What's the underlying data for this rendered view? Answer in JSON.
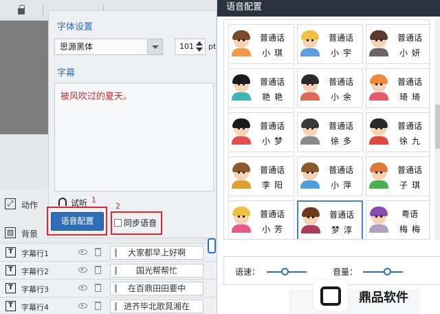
{
  "editor": {
    "tools": [
      {
        "label": "动作"
      },
      {
        "label": "背景"
      }
    ],
    "tracks": [
      {
        "label": "字幕行1",
        "clip": "大家都早上好啊"
      },
      {
        "label": "字幕行2",
        "clip": "国光帮帮忙"
      },
      {
        "label": "字幕行3",
        "clip": "在百鼎田田要中"
      },
      {
        "label": "字幕行4",
        "clip": "进齐毕北歌晁湘在"
      }
    ]
  },
  "font_panel": {
    "font_heading": "字体设置",
    "font_name": "思源黑体",
    "font_size": "101",
    "unit": "pt",
    "subtitle_heading": "字幕",
    "subtitle_text": "被风吹过的夏天。",
    "listen_label": "试听",
    "voice_config_button": "语音配置",
    "sync_voice_label": "同步语音",
    "sync_voice_checked": false,
    "annotation_1": "1",
    "annotation_2": "2"
  },
  "voice_dialog": {
    "title": "语音配置",
    "voices": [
      {
        "type": "普通话",
        "name": "小琪",
        "hair": "#7a4a2a",
        "shirt": "#f29a4a"
      },
      {
        "type": "普通话",
        "name": "小宇",
        "hair": "#f0c040",
        "shirt": "#5aa0e0"
      },
      {
        "type": "普通话",
        "name": "小妍",
        "hair": "#5a3a2a",
        "shirt": "#666666"
      },
      {
        "type": "普通话",
        "name": "艳艳",
        "hair": "#1c1c1c",
        "shirt": "#3fb6b6"
      },
      {
        "type": "普通话",
        "name": "小余",
        "hair": "#2a2a2a",
        "shirt": "#e06a5a"
      },
      {
        "type": "普通话",
        "name": "琦琦",
        "hair": "#f08a3a",
        "shirt": "#e85a6a"
      },
      {
        "type": "普通话",
        "name": "小梦",
        "hair": "#1c1c1c",
        "shirt": "#e05050"
      },
      {
        "type": "普通话",
        "name": "徐多",
        "hair": "#3a3a3a",
        "shirt": "#8a8a8a"
      },
      {
        "type": "普通话",
        "name": "徐九",
        "hair": "#2a2a2a",
        "shirt": "#e04a3a"
      },
      {
        "type": "普通话",
        "name": "李阳",
        "hair": "#8a5a2a",
        "shirt": "#e0a030"
      },
      {
        "type": "普通话",
        "name": "小萍",
        "hair": "#8a5a2a",
        "shirt": "#4aa0e0"
      },
      {
        "type": "普通话",
        "name": "子琪",
        "hair": "#e07a3a",
        "shirt": "#4ab050"
      },
      {
        "type": "普通话",
        "name": "小芳",
        "hair": "#f0c040",
        "shirt": "#e85a8a"
      },
      {
        "type": "普通话",
        "name": "梦淳",
        "hair": "#6a3a1a",
        "shirt": "#b03a5a",
        "selected": true
      },
      {
        "type": "粤语",
        "name": "梅梅",
        "hair": "#8a4ab0",
        "shirt": "#b0a0c0"
      }
    ],
    "speed_label": "语速：",
    "volume_label": "音量：",
    "speed_value": 0.45,
    "volume_value": 0.6
  },
  "watermark": {
    "text": "鼎品软件"
  }
}
